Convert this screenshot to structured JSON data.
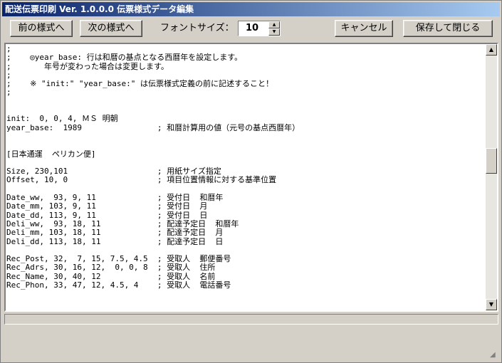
{
  "window": {
    "title": "配送伝票印刷 Ver. 1.0.0.0 伝票様式データ編集"
  },
  "toolbar": {
    "prev_label": "前の様式へ",
    "next_label": "次の様式へ",
    "font_size_label": "フォントサイズ：",
    "font_size_value": "10",
    "cancel_label": "キャンセル",
    "save_close_label": "保存して閉じる"
  },
  "editor": {
    "lines": [
      ";",
      ";    ◎year_base: 行は和暦の基点となる西暦年を設定します。",
      ";       年号が変わった場合は変更します。",
      ";",
      ";    ※ \"init:\" \"year_base:\" は伝票様式定義の前に記述すること！",
      ";",
      "",
      "",
      "init:  0, 0, 4, ＭＳ 明朝",
      "year_base:  1989                ; 和暦計算用の値（元号の基点西暦年）",
      "",
      "",
      "[日本通運  ペリカン便]",
      "",
      "Size, 230,101                   ; 用紙サイズ指定",
      "Offset, 10, 0                   ; 項目位置情報に対する基準位置",
      "",
      "Date_ww,  93, 9, 11             ; 受付日  和暦年",
      "Date_mm, 103, 9, 11             ; 受付日  月",
      "Date_dd, 113, 9, 11             ; 受付日  日",
      "Deli_ww,  93, 18, 11            ; 配達予定日  和暦年",
      "Deli_mm, 103, 18, 11            ; 配達予定日  月",
      "Deli_dd, 113, 18, 11            ; 配達予定日  日",
      "",
      "Rec_Post, 32,  7, 15, 7.5, 4.5  ; 受取人  郵便番号",
      "Rec_Adrs, 30, 16, 12,  0, 0, 8  ; 受取人  住所",
      "Rec_Name, 30, 40, 12            ; 受取人  名前",
      "Rec_Phon, 33, 47, 12, 4.5, 4    ; 受取人  電話番号"
    ]
  }
}
